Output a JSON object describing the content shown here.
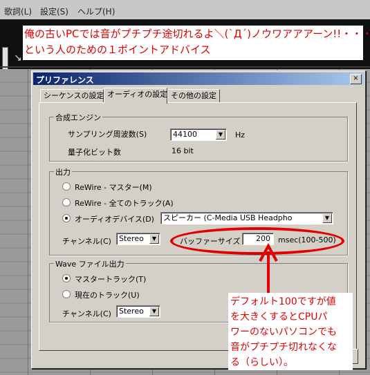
{
  "menu": [
    "歌詞(L)",
    "設定(S)",
    "ヘルプ(H)"
  ],
  "banner": {
    "line1": "俺の古いPCでは音がプチプチ途切れるよ＼(`Д´)ノウワアアアーン!!・・・",
    "line2": "という人のための１ポイントアドバイス"
  },
  "dialog": {
    "title": "プリファレンス",
    "close": "×",
    "tabs": [
      "シーケンスの設定",
      "オーディオの設定",
      "その他の設定"
    ],
    "active_tab": 1,
    "synth": {
      "group_label": "合成エンジン",
      "sampling_label": "サンプリング周波数(S)",
      "sampling_value": "44100",
      "sampling_unit": "Hz",
      "bit_label": "量子化ビット数",
      "bit_value": "16 bit"
    },
    "output": {
      "group_label": "出力",
      "radio_rewire_master": "ReWire - マスター(M)",
      "radio_rewire_all": "ReWire - 全てのトラック(A)",
      "radio_audio_device": "オーディオデバイス(D)",
      "selected": "audio_device",
      "device_value": "スピーカー (C-Media USB Headpho",
      "channel_label": "チャンネル(C)",
      "channel_value": "Stereo",
      "buffer_label": "バッファーサイズ",
      "buffer_value": "200",
      "buffer_unit": "msec(100-500)"
    },
    "wave": {
      "group_label": "Wave ファイル出力",
      "radio_master": "マスタートラック(T)",
      "radio_current": "現在のトラック(U)",
      "selected": "master",
      "channel_label": "チャンネル(C)",
      "channel_value": "Stereo"
    }
  },
  "annotation": {
    "lines": [
      "デフォルト100ですが値",
      "を大きくするとCPUパ",
      "ワーのないパソコンでも",
      "音がプチプチ切れなくな",
      "る（らしい）。"
    ]
  },
  "colors": {
    "annotation_red": "#e00000",
    "titlebar": "#0a246a"
  }
}
